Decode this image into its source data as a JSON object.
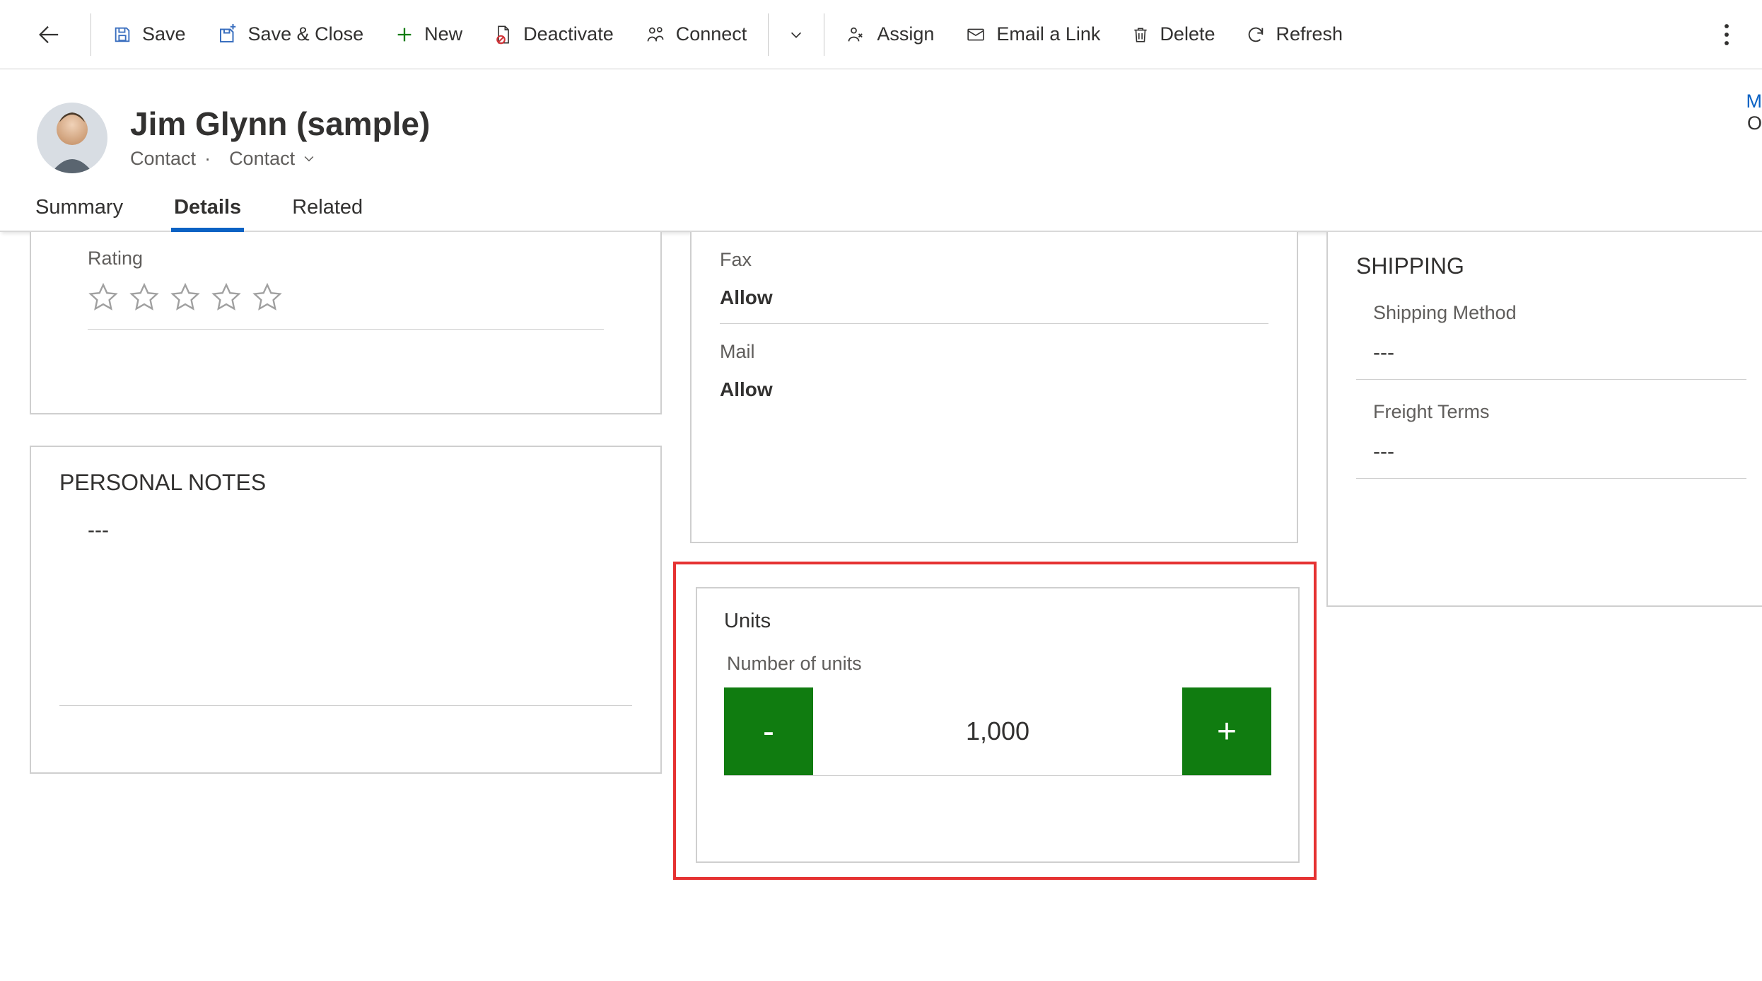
{
  "toolbar": {
    "save": "Save",
    "save_close": "Save & Close",
    "new": "New",
    "deactivate": "Deactivate",
    "connect": "Connect",
    "assign": "Assign",
    "email_link": "Email a Link",
    "delete": "Delete",
    "refresh": "Refresh"
  },
  "header": {
    "title": "Jim Glynn (sample)",
    "entity": "Contact",
    "dot": "·",
    "form": "Contact",
    "rletter1": "M",
    "rletter2": "O"
  },
  "tabs": {
    "summary": "Summary",
    "details": "Details",
    "related": "Related"
  },
  "left": {
    "rating_label": "Rating",
    "notes_title": "PERSONAL NOTES",
    "notes_value": "---"
  },
  "prefs": {
    "fax_label": "Fax",
    "fax_value": "Allow",
    "mail_label": "Mail",
    "mail_value": "Allow"
  },
  "units": {
    "title": "Units",
    "label": "Number of units",
    "minus": "-",
    "value": "1,000",
    "plus": "+"
  },
  "shipping": {
    "title": "SHIPPING",
    "method_label": "Shipping Method",
    "method_value": "---",
    "freight_label": "Freight Terms",
    "freight_value": "---"
  }
}
